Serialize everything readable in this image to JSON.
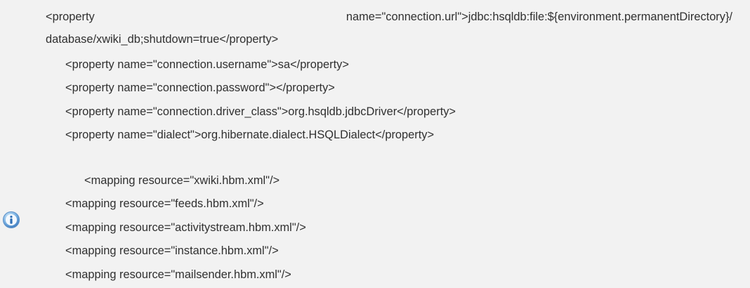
{
  "note": {
    "icon": "info-icon",
    "line1_tag": "<property",
    "line1_rest": "name=\"connection.url\">jdbc:hsqldb:file:${environment.permanentDirectory}/",
    "line2": "database/xwiki_db;shutdown=true</property>",
    "line3": "<property name=\"connection.username\">sa</property>",
    "line4": "<property name=\"connection.password\"></property>",
    "line5": "<property name=\"connection.driver_class\">org.hsqldb.jdbcDriver</property>",
    "line6": "<property name=\"dialect\">org.hibernate.dialect.HSQLDialect</property>",
    "line7": "<mapping resource=\"xwiki.hbm.xml\"/>",
    "line8": "<mapping resource=\"feeds.hbm.xml\"/>",
    "line9": "<mapping resource=\"activitystream.hbm.xml\"/>",
    "line10": "<mapping resource=\"instance.hbm.xml\"/>",
    "line11": "<mapping resource=\"mailsender.hbm.xml\"/>"
  }
}
